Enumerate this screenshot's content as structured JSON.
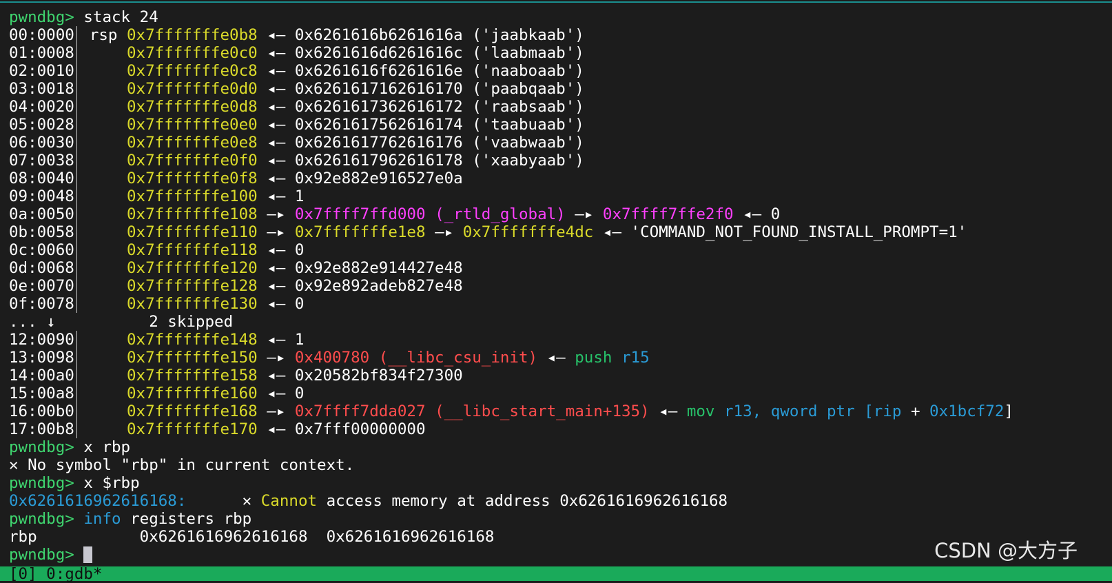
{
  "prompt": "pwndbg>",
  "cmd_stack": "stack 24",
  "stack_rows": {
    "r00": {
      "off": "00:0000",
      "label": "rsp",
      "addr": "0x7fffffffe0b8",
      "arrow": "◂—",
      "val": "0x6261616b6261616a",
      "str": "('jaabkaab')"
    },
    "r01": {
      "off": "01:0008",
      "addr": "0x7fffffffe0c0",
      "arrow": "◂—",
      "val": "0x6261616d6261616c",
      "str": "('laabmaab')"
    },
    "r02": {
      "off": "02:0010",
      "addr": "0x7fffffffe0c8",
      "arrow": "◂—",
      "val": "0x6261616f6261616e",
      "str": "('naaboaab')"
    },
    "r03": {
      "off": "03:0018",
      "addr": "0x7fffffffe0d0",
      "arrow": "◂—",
      "val": "0x6261617162616170",
      "str": "('paabqaab')"
    },
    "r04": {
      "off": "04:0020",
      "addr": "0x7fffffffe0d8",
      "arrow": "◂—",
      "val": "0x6261617362616172",
      "str": "('raabsaab')"
    },
    "r05": {
      "off": "05:0028",
      "addr": "0x7fffffffe0e0",
      "arrow": "◂—",
      "val": "0x6261617562616174",
      "str": "('taabuaab')"
    },
    "r06": {
      "off": "06:0030",
      "addr": "0x7fffffffe0e8",
      "arrow": "◂—",
      "val": "0x6261617762616176",
      "str": "('vaabwaab')"
    },
    "r07": {
      "off": "07:0038",
      "addr": "0x7fffffffe0f0",
      "arrow": "◂—",
      "val": "0x6261617962616178",
      "str": "('xaabyaab')"
    },
    "r08": {
      "off": "08:0040",
      "addr": "0x7fffffffe0f8",
      "arrow": "◂—",
      "val": "0x92e882e916527e0a"
    },
    "r09": {
      "off": "09:0048",
      "addr": "0x7fffffffe100",
      "arrow": "◂—",
      "val": "1"
    },
    "r0a": {
      "off": "0a:0050",
      "addr": "0x7fffffffe108",
      "arrow": "—▸",
      "p1": "0x7ffff7ffd000",
      "sym": "(_rtld_global)",
      "arrow2": "—▸",
      "p2": "0x7ffff7ffe2f0",
      "arrow3": "◂—",
      "val": "0"
    },
    "r0b": {
      "off": "0b:0058",
      "addr": "0x7fffffffe110",
      "arrow": "—▸",
      "p1": "0x7fffffffe1e8",
      "arrow2": "—▸",
      "p2": "0x7fffffffe4dc",
      "arrow3": "◂—",
      "val": "'COMMAND_NOT_FOUND_INSTALL_PROMPT=1'"
    },
    "r0c": {
      "off": "0c:0060",
      "addr": "0x7fffffffe118",
      "arrow": "◂—",
      "val": "0"
    },
    "r0d": {
      "off": "0d:0068",
      "addr": "0x7fffffffe120",
      "arrow": "◂—",
      "val": "0x92e882e914427e48"
    },
    "r0e": {
      "off": "0e:0070",
      "addr": "0x7fffffffe128",
      "arrow": "◂—",
      "val": "0x92e892adeb827e48"
    },
    "r0f": {
      "off": "0f:0078",
      "addr": "0x7fffffffe130",
      "arrow": "◂—",
      "val": "0"
    },
    "skip": {
      "off": "... ↓",
      "text": "2 skipped"
    },
    "r12": {
      "off": "12:0090",
      "addr": "0x7fffffffe148",
      "arrow": "◂—",
      "val": "1"
    },
    "r13": {
      "off": "13:0098",
      "addr": "0x7fffffffe150",
      "arrow": "—▸",
      "p1": "0x400780",
      "sym": "(__libc_csu_init)",
      "arrow2": "◂—",
      "ins": "push",
      "reg": "r15"
    },
    "r14": {
      "off": "14:00a0",
      "addr": "0x7fffffffe158",
      "arrow": "◂—",
      "val": "0x20582bf834f27300"
    },
    "r15": {
      "off": "15:00a8",
      "addr": "0x7fffffffe160",
      "arrow": "◂—",
      "val": "0"
    },
    "r16": {
      "off": "16:00b0",
      "addr": "0x7fffffffe168",
      "arrow": "—▸",
      "p1": "0x7ffff7dda027",
      "sym": "(__libc_start_main+135)",
      "arrow2": "◂—",
      "ins": "mov",
      "reg": "r13,",
      "kw": "qword ptr",
      "br1": "[",
      "rip": "rip",
      "plus": "+",
      "imm": "0x1bcf72",
      "br2": "]"
    },
    "r17": {
      "off": "17:00b8",
      "addr": "0x7fffffffe170",
      "arrow": "◂—",
      "val": "0x7fff00000000"
    }
  },
  "cmd_x_rbp": "x rbp",
  "err_rbp_icon": "✕",
  "err_rbp": "No symbol \"rbp\" in current context.",
  "cmd_x_drbp": "x $rbp",
  "mem_addr": "0x6261616962616168:",
  "err_mem_icon": "✕",
  "err_mem_word": "Cannot",
  "err_mem_rest": "access memory at address 0x6261616962616168",
  "cmd_info": "info",
  "cmd_info_rest": "registers rbp",
  "reg_name": "rbp",
  "reg_hex": "0x6261616962616168",
  "reg_val": "0x6261616962616168",
  "status_bar": "[0] 0:gdb*",
  "watermark": "CSDN @大方子",
  "icons": {
    "error": "x-icon",
    "cursor": "block-cursor"
  },
  "colors": {
    "prompt": "#3fd56f",
    "address": "#dada2a",
    "pointer_data": "#ff40ff",
    "pointer_code": "#ff4d4d",
    "register": "#2a9bd6",
    "status_bar": "#1aaa5a"
  }
}
